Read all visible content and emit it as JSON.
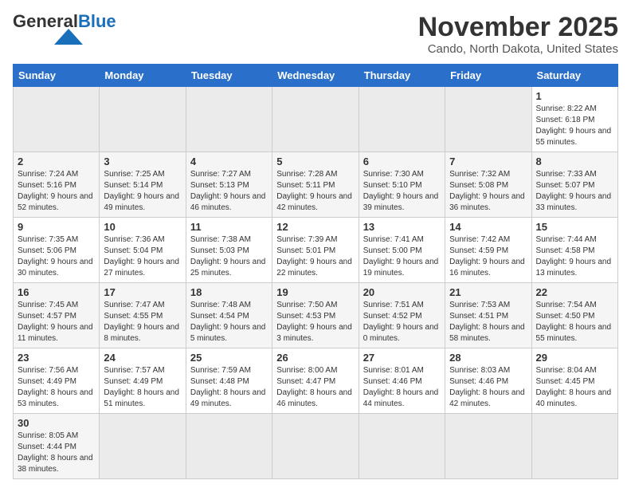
{
  "logo": {
    "text_general": "General",
    "text_blue": "Blue"
  },
  "title": {
    "month_year": "November 2025",
    "location": "Cando, North Dakota, United States"
  },
  "weekdays": [
    "Sunday",
    "Monday",
    "Tuesday",
    "Wednesday",
    "Thursday",
    "Friday",
    "Saturday"
  ],
  "weeks": [
    [
      {
        "day": "",
        "info": ""
      },
      {
        "day": "",
        "info": ""
      },
      {
        "day": "",
        "info": ""
      },
      {
        "day": "",
        "info": ""
      },
      {
        "day": "",
        "info": ""
      },
      {
        "day": "",
        "info": ""
      },
      {
        "day": "1",
        "info": "Sunrise: 8:22 AM\nSunset: 6:18 PM\nDaylight: 9 hours and 55 minutes."
      }
    ],
    [
      {
        "day": "2",
        "info": "Sunrise: 7:24 AM\nSunset: 5:16 PM\nDaylight: 9 hours and 52 minutes."
      },
      {
        "day": "3",
        "info": "Sunrise: 7:25 AM\nSunset: 5:14 PM\nDaylight: 9 hours and 49 minutes."
      },
      {
        "day": "4",
        "info": "Sunrise: 7:27 AM\nSunset: 5:13 PM\nDaylight: 9 hours and 46 minutes."
      },
      {
        "day": "5",
        "info": "Sunrise: 7:28 AM\nSunset: 5:11 PM\nDaylight: 9 hours and 42 minutes."
      },
      {
        "day": "6",
        "info": "Sunrise: 7:30 AM\nSunset: 5:10 PM\nDaylight: 9 hours and 39 minutes."
      },
      {
        "day": "7",
        "info": "Sunrise: 7:32 AM\nSunset: 5:08 PM\nDaylight: 9 hours and 36 minutes."
      },
      {
        "day": "8",
        "info": "Sunrise: 7:33 AM\nSunset: 5:07 PM\nDaylight: 9 hours and 33 minutes."
      }
    ],
    [
      {
        "day": "9",
        "info": "Sunrise: 7:35 AM\nSunset: 5:06 PM\nDaylight: 9 hours and 30 minutes."
      },
      {
        "day": "10",
        "info": "Sunrise: 7:36 AM\nSunset: 5:04 PM\nDaylight: 9 hours and 27 minutes."
      },
      {
        "day": "11",
        "info": "Sunrise: 7:38 AM\nSunset: 5:03 PM\nDaylight: 9 hours and 25 minutes."
      },
      {
        "day": "12",
        "info": "Sunrise: 7:39 AM\nSunset: 5:01 PM\nDaylight: 9 hours and 22 minutes."
      },
      {
        "day": "13",
        "info": "Sunrise: 7:41 AM\nSunset: 5:00 PM\nDaylight: 9 hours and 19 minutes."
      },
      {
        "day": "14",
        "info": "Sunrise: 7:42 AM\nSunset: 4:59 PM\nDaylight: 9 hours and 16 minutes."
      },
      {
        "day": "15",
        "info": "Sunrise: 7:44 AM\nSunset: 4:58 PM\nDaylight: 9 hours and 13 minutes."
      }
    ],
    [
      {
        "day": "16",
        "info": "Sunrise: 7:45 AM\nSunset: 4:57 PM\nDaylight: 9 hours and 11 minutes."
      },
      {
        "day": "17",
        "info": "Sunrise: 7:47 AM\nSunset: 4:55 PM\nDaylight: 9 hours and 8 minutes."
      },
      {
        "day": "18",
        "info": "Sunrise: 7:48 AM\nSunset: 4:54 PM\nDaylight: 9 hours and 5 minutes."
      },
      {
        "day": "19",
        "info": "Sunrise: 7:50 AM\nSunset: 4:53 PM\nDaylight: 9 hours and 3 minutes."
      },
      {
        "day": "20",
        "info": "Sunrise: 7:51 AM\nSunset: 4:52 PM\nDaylight: 9 hours and 0 minutes."
      },
      {
        "day": "21",
        "info": "Sunrise: 7:53 AM\nSunset: 4:51 PM\nDaylight: 8 hours and 58 minutes."
      },
      {
        "day": "22",
        "info": "Sunrise: 7:54 AM\nSunset: 4:50 PM\nDaylight: 8 hours and 55 minutes."
      }
    ],
    [
      {
        "day": "23",
        "info": "Sunrise: 7:56 AM\nSunset: 4:49 PM\nDaylight: 8 hours and 53 minutes."
      },
      {
        "day": "24",
        "info": "Sunrise: 7:57 AM\nSunset: 4:49 PM\nDaylight: 8 hours and 51 minutes."
      },
      {
        "day": "25",
        "info": "Sunrise: 7:59 AM\nSunset: 4:48 PM\nDaylight: 8 hours and 49 minutes."
      },
      {
        "day": "26",
        "info": "Sunrise: 8:00 AM\nSunset: 4:47 PM\nDaylight: 8 hours and 46 minutes."
      },
      {
        "day": "27",
        "info": "Sunrise: 8:01 AM\nSunset: 4:46 PM\nDaylight: 8 hours and 44 minutes."
      },
      {
        "day": "28",
        "info": "Sunrise: 8:03 AM\nSunset: 4:46 PM\nDaylight: 8 hours and 42 minutes."
      },
      {
        "day": "29",
        "info": "Sunrise: 8:04 AM\nSunset: 4:45 PM\nDaylight: 8 hours and 40 minutes."
      }
    ],
    [
      {
        "day": "30",
        "info": "Sunrise: 8:05 AM\nSunset: 4:44 PM\nDaylight: 8 hours and 38 minutes."
      },
      {
        "day": "",
        "info": ""
      },
      {
        "day": "",
        "info": ""
      },
      {
        "day": "",
        "info": ""
      },
      {
        "day": "",
        "info": ""
      },
      {
        "day": "",
        "info": ""
      },
      {
        "day": "",
        "info": ""
      }
    ]
  ]
}
